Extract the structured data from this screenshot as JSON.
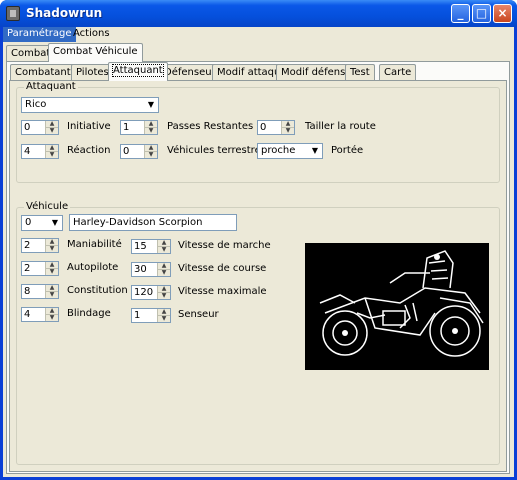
{
  "window": {
    "title": "Shadowrun"
  },
  "menu": [
    "Paramétrage",
    "Actions"
  ],
  "top_tabs": [
    "Combat",
    "Combat Véhicule"
  ],
  "sub_tabs": [
    "Combatants",
    "Pilotes",
    "Attaquant",
    "Défenseur",
    "Modif attaque",
    "Modif défense",
    "Test",
    "Carte"
  ],
  "attaquant": {
    "group_title": "Attaquant",
    "selected": "Rico",
    "initiative": {
      "value": "0",
      "label": "Initiative"
    },
    "passes": {
      "value": "1",
      "label": "Passes Restantes"
    },
    "tailler": {
      "value": "0",
      "label": "Tailler la route"
    },
    "reaction": {
      "value": "4",
      "label": "Réaction"
    },
    "vehicules": {
      "value": "0",
      "label": "Véhicules terrestres"
    },
    "portee": {
      "value": "proche",
      "label": "Portée"
    }
  },
  "vehicule": {
    "group_title": "Véhicule",
    "index": "0",
    "name": "Harley-Davidson Scorpion",
    "maniabilite": {
      "value": "2",
      "label": "Maniabilité"
    },
    "autopilote": {
      "value": "2",
      "label": "Autopilote"
    },
    "constitution": {
      "value": "8",
      "label": "Constitution"
    },
    "blindage": {
      "value": "4",
      "label": "Blindage"
    },
    "vitesse_marche": {
      "value": "15",
      "label": "Vitesse de marche"
    },
    "vitesse_course": {
      "value": "30",
      "label": "Vitesse de course"
    },
    "vitesse_max": {
      "value": "120",
      "label": "Vitesse maximale"
    },
    "senseur": {
      "value": "1",
      "label": "Senseur"
    }
  }
}
